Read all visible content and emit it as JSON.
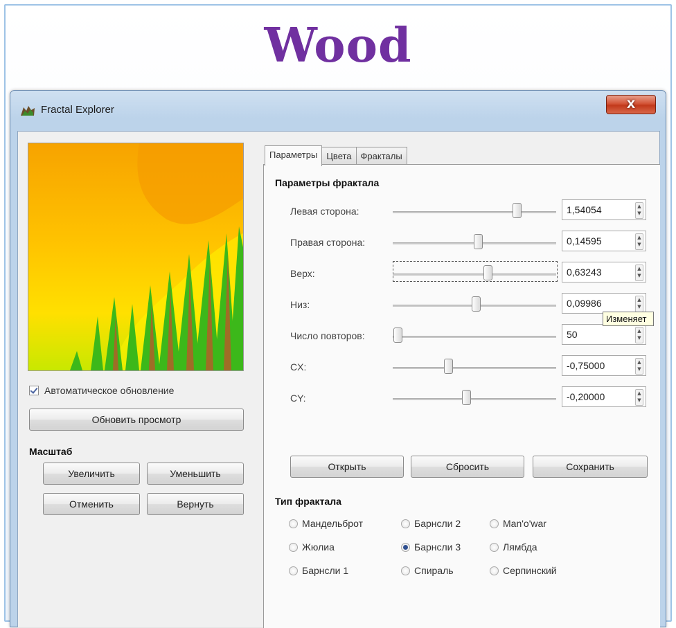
{
  "slide": {
    "title": "Wood"
  },
  "window": {
    "title": "Fractal Explorer",
    "close_label": "X"
  },
  "left": {
    "auto_update_label": "Автоматическое обновление",
    "auto_update_checked": true,
    "refresh_button": "Обновить просмотр",
    "zoom_title": "Масштаб",
    "zoom_in": "Увеличить",
    "zoom_out": "Уменьшить",
    "undo": "Отменить",
    "redo": "Вернуть"
  },
  "tabs": [
    {
      "label": "Параметры",
      "active": true
    },
    {
      "label": "Цвета",
      "active": false
    },
    {
      "label": "Фракталы",
      "active": false
    }
  ],
  "params": {
    "title": "Параметры фрактала",
    "rows": [
      {
        "label": "Левая сторона:",
        "value": "1,54054",
        "level": 0.76
      },
      {
        "label": "Правая сторона:",
        "value": "0,14595",
        "level": 0.52
      },
      {
        "label": "Верх:",
        "value": "0,63243",
        "level": 0.58,
        "focused": true
      },
      {
        "label": "Низ:",
        "value": "0,09986",
        "level": 0.51
      },
      {
        "label": "Число повторов:",
        "value": "50",
        "level": 0.03
      },
      {
        "label": "CX:",
        "value": "-0,75000",
        "level": 0.34
      },
      {
        "label": "CY:",
        "value": "-0,20000",
        "level": 0.45
      }
    ],
    "open_button": "Открыть",
    "reset_button": "Сбросить",
    "save_button": "Сохранить",
    "tooltip": "Изменяет"
  },
  "fractal_type": {
    "title": "Тип фрактала",
    "options": [
      {
        "label": "Мандельброт",
        "selected": false
      },
      {
        "label": "Барнсли 2",
        "selected": false
      },
      {
        "label": "Man'o'war",
        "selected": false
      },
      {
        "label": "Жюлиа",
        "selected": false
      },
      {
        "label": "Барнсли 3",
        "selected": true
      },
      {
        "label": "Лямбда",
        "selected": false
      },
      {
        "label": "Барнсли 1",
        "selected": false
      },
      {
        "label": "Спираль",
        "selected": false
      },
      {
        "label": "Серпинский",
        "selected": false
      }
    ]
  },
  "colors": {
    "title": "#7030a0",
    "preview_top": "#f7a500",
    "preview_mid": "#ffd400",
    "preview_green": "#3cb81a"
  }
}
